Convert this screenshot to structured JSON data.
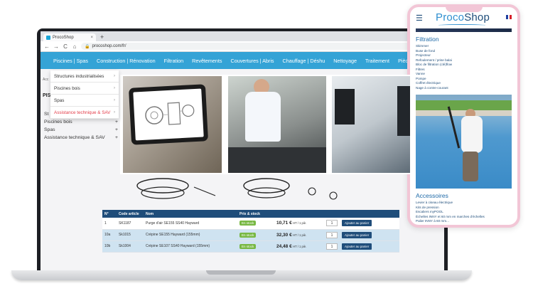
{
  "browser": {
    "tab_title": "ProcoShop",
    "tab_close": "×",
    "new_tab": "+",
    "url": "procoshop.com/fr/",
    "back": "←",
    "forward": "→",
    "reload": "C",
    "home": "⌂",
    "lock": "🔒"
  },
  "site_nav": {
    "items": [
      "Piscines | Spas",
      "Construction | Rénovation",
      "Filtration",
      "Revêtements",
      "Couvertures | Abris",
      "Chauffage | Déshu",
      "Nettoyage",
      "Traitement",
      "Pièces détachées"
    ]
  },
  "dropdown": {
    "items": [
      {
        "label": "Structures industrialisées",
        "caret": "›"
      },
      {
        "label": "Piscines bois",
        "caret": "›"
      },
      {
        "label": "Spas",
        "caret": "›"
      },
      {
        "label": "Assistance technique & SAV",
        "caret": "›"
      }
    ]
  },
  "sidebar": {
    "acc_label": "Acc",
    "head": "PIS",
    "items": [
      {
        "label": "St",
        "mark": "+"
      },
      {
        "label": "Piscines bois",
        "mark": "+"
      },
      {
        "label": "Spas",
        "mark": "+"
      },
      {
        "label": "Assistance technique & SAV",
        "mark": "+"
      }
    ]
  },
  "parts_table": {
    "headers": [
      "N°",
      "Code article",
      "Nom",
      "",
      "Prix & stock",
      "",
      "",
      ""
    ],
    "rows": [
      {
        "num": "1",
        "code": "SK1187",
        "name": "Purge d'air SE155 SS40 Hayward",
        "stock": "En stock",
        "price": "10,71 €",
        "unit": "HT / 1 piè.",
        "qty": "1",
        "button": "Ajouter au panier"
      },
      {
        "num": "10a",
        "code": "Sk1015",
        "name": "Crépine SE155 Hayward (155mm)",
        "stock": "En stock",
        "price": "32,30 €",
        "unit": "HT / 1 piè.",
        "qty": "1",
        "button": "Ajouter au panier"
      },
      {
        "num": "10b",
        "code": "Sk1004",
        "name": "Crépine SE107 SS40 Hayward (155mm)",
        "stock": "En stock",
        "price": "24,48 €",
        "unit": "HT / 1 piè.",
        "qty": "1",
        "button": "Ajouter au panier"
      }
    ]
  },
  "phone": {
    "logo_a": "Proco",
    "logo_b": "Shop",
    "section1_title": "Filtration",
    "section1_links": [
      "Skimmer",
      "Buse de fond",
      "Projecteur",
      "Refoulement / prise balai",
      "Bloc de filtration (clé)flow",
      "Filtres",
      "Vanne",
      "Pompe",
      "Coffret électrique",
      "Nage à contre-courant"
    ],
    "section2_title": "Accessoires",
    "section2_links": [
      "Levier à ciseau électrique",
      "Kits de pression",
      "Escaliers myPOOL",
      "Échelles INNY et 60 mm en marches d'échelles",
      "Palier INNY à 60 mm..."
    ]
  },
  "colors": {
    "nav_blue": "#34a3d6",
    "dark_blue": "#1f4d7a",
    "active_red": "#e33d4a",
    "stock_green": "#78b843",
    "phone_frame": "#f2c6d6"
  }
}
